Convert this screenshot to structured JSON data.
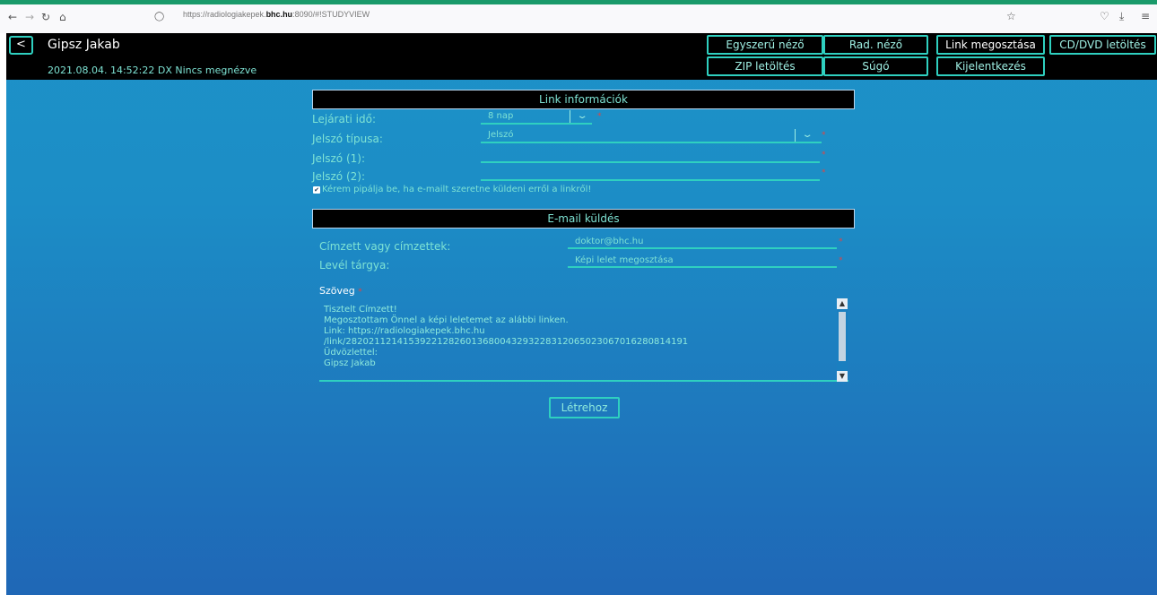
{
  "browser": {
    "url_prefix": "https://radiologiakepek.",
    "url_domain": "bhc.hu",
    "url_suffix": ":8090/#!STUDYVIEW"
  },
  "header": {
    "back": "<",
    "user_name": "Gipsz Jakab",
    "study_info": "2021.08.04. 14:52:22 DX Nincs megnézve",
    "buttons": {
      "simple_viewer": "Egyszerű néző",
      "rad_viewer": "Rad. néző",
      "link_share": "Link megosztása",
      "cd_download": "CD/DVD letöltés",
      "zip_download": "ZIP letöltés",
      "help": "Súgó",
      "logout": "Kijelentkezés"
    }
  },
  "link_info": {
    "title": "Link információk",
    "expiry_label": "Lejárati idő:",
    "expiry_value": "8 nap",
    "password_type_label": "Jelszó típusa:",
    "password_type_value": "Jelszó",
    "password1_label": "Jelszó (1):",
    "password2_label": "Jelszó (2):",
    "email_checkbox_label": "Kérem pipálja be, ha e-mailt szeretne küldeni erről a linkről!",
    "required_mark": "*"
  },
  "email": {
    "title": "E-mail küldés",
    "recipient_label": "Címzett vagy címzettek:",
    "recipient_value": "doktor@bhc.hu",
    "subject_label": "Levél tárgya:",
    "subject_value": "Képi lelet megosztása",
    "body_label": "Szöveg",
    "body_lines": [
      "Tisztelt Címzett!",
      "",
      "Megosztottam Önnel a képi leletemet az alábbi linken.",
      "Link: https://radiologiakepek.bhc.hu",
      "/link/282021121415392212826013680043293228312065023067016280814191",
      "Üdvözlettel:",
      "Gipsz Jakab"
    ]
  },
  "actions": {
    "create": "Létrehoz"
  }
}
